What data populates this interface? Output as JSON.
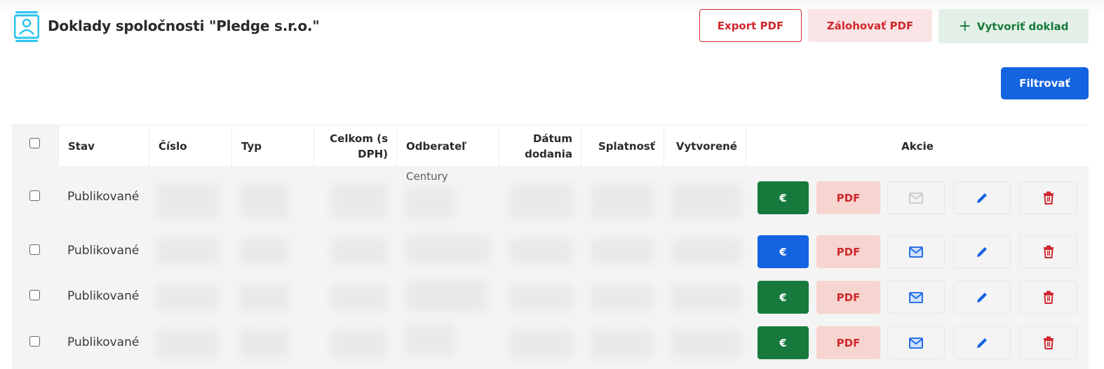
{
  "header": {
    "title": "Doklady spoločnosti \"Pledge s.r.o.\"",
    "logo_icon": "invoice-card-icon",
    "buttons": {
      "export_pdf": "Export PDF",
      "backup_pdf": "Zálohovať PDF",
      "create_document": "Vytvoriť doklad",
      "create_icon": "+"
    },
    "filter_button": "Filtrovať"
  },
  "table": {
    "columns": {
      "stav": "Stav",
      "cislo": "Číslo",
      "typ": "Typ",
      "celkom": "Celkom (s DPH)",
      "odberatel": "Odberateľ",
      "datum": "Dátum dodania",
      "splatnost": "Splatnosť",
      "vytvorene": "Vytvorené",
      "akcie": "Akcie"
    },
    "rows": [
      {
        "stav": "Publikované",
        "odberatel_partial": "Century",
        "pay_icon": "€",
        "pay_color": "#177a3c",
        "pdf": "PDF",
        "mail_enabled": false
      },
      {
        "stav": "Publikované",
        "pay_icon": "€",
        "pay_color": "#1463e0",
        "pdf": "PDF",
        "mail_enabled": true
      },
      {
        "stav": "Publikované",
        "pay_icon": "€",
        "pay_color": "#177a3c",
        "pdf": "PDF",
        "mail_enabled": true
      },
      {
        "stav": "Publikované",
        "pay_icon": "€",
        "pay_color": "#177a3c",
        "pdf": "PDF",
        "mail_enabled": true
      }
    ]
  },
  "colors": {
    "primary_blue": "#1463e0",
    "green": "#177a3c",
    "red": "#d0282e",
    "pink_bg": "#fbe4e5",
    "logo_cyan": "#2ec4ec"
  }
}
